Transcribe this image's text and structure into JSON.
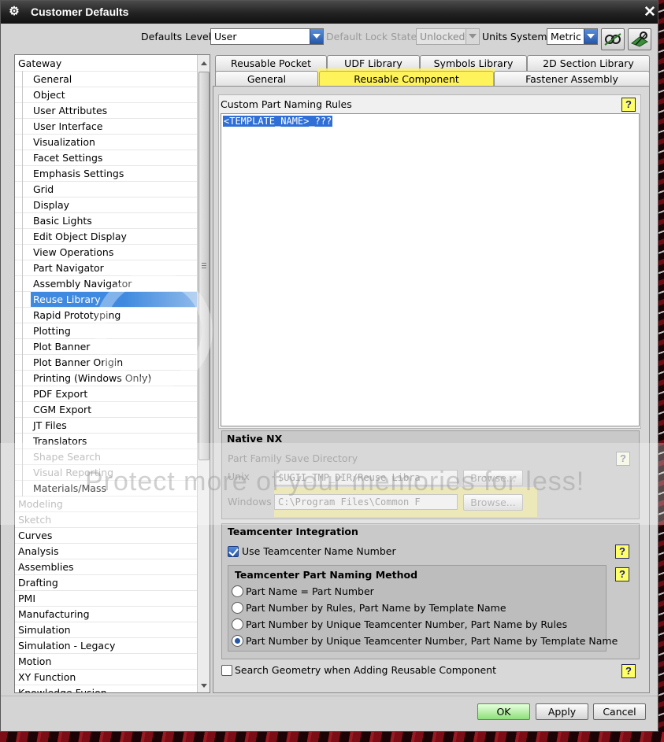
{
  "window": {
    "title": "Customer Defaults",
    "close_glyph": "✕",
    "app_icon": "gear-icon"
  },
  "toolbar": {
    "defaults_level_label": "Defaults Level",
    "defaults_level_value": "User",
    "lock_state_label": "Default Lock State",
    "lock_state_value": "Unlocked",
    "units_label": "Units System",
    "units_value": "Metric",
    "icons": [
      "find-default-icon",
      "manage-defaults-icon"
    ]
  },
  "nav": {
    "items": [
      {
        "label": "Gateway",
        "level": 1
      },
      {
        "label": "General",
        "level": 2
      },
      {
        "label": "Object",
        "level": 2
      },
      {
        "label": "User Attributes",
        "level": 2
      },
      {
        "label": "User Interface",
        "level": 2
      },
      {
        "label": "Visualization",
        "level": 2
      },
      {
        "label": "Facet Settings",
        "level": 2
      },
      {
        "label": "Emphasis Settings",
        "level": 2
      },
      {
        "label": "Grid",
        "level": 2
      },
      {
        "label": "Display",
        "level": 2
      },
      {
        "label": "Basic Lights",
        "level": 2
      },
      {
        "label": "Edit Object Display",
        "level": 2
      },
      {
        "label": "View Operations",
        "level": 2
      },
      {
        "label": "Part Navigator",
        "level": 2
      },
      {
        "label": "Assembly Navigator",
        "level": 2
      },
      {
        "label": "Reuse Library",
        "level": 2,
        "selected": true
      },
      {
        "label": "Rapid Prototyping",
        "level": 2
      },
      {
        "label": "Plotting",
        "level": 2
      },
      {
        "label": "Plot Banner",
        "level": 2
      },
      {
        "label": "Plot Banner Origin",
        "level": 2
      },
      {
        "label": "Printing (Windows Only)",
        "level": 2
      },
      {
        "label": "PDF Export",
        "level": 2
      },
      {
        "label": "CGM Export",
        "level": 2
      },
      {
        "label": "JT Files",
        "level": 2
      },
      {
        "label": "Translators",
        "level": 2
      },
      {
        "label": "Shape Search",
        "level": 2,
        "grey": true
      },
      {
        "label": "Visual Reporting",
        "level": 2,
        "grey": true
      },
      {
        "label": "Materials/Mass",
        "level": 2
      },
      {
        "label": "Modeling",
        "level": 1,
        "grey": true
      },
      {
        "label": "Sketch",
        "level": 1,
        "grey": true
      },
      {
        "label": "Curves",
        "level": 1
      },
      {
        "label": "Analysis",
        "level": 1
      },
      {
        "label": "Assemblies",
        "level": 1
      },
      {
        "label": "Drafting",
        "level": 1
      },
      {
        "label": "PMI",
        "level": 1
      },
      {
        "label": "Manufacturing",
        "level": 1
      },
      {
        "label": "Simulation",
        "level": 1
      },
      {
        "label": "Simulation - Legacy",
        "level": 1
      },
      {
        "label": "Motion",
        "level": 1
      },
      {
        "label": "XY Function",
        "level": 1
      },
      {
        "label": "Knowledge Fusion",
        "level": 1
      }
    ]
  },
  "tabs": {
    "row1": [
      "Reusable Pocket",
      "UDF Library",
      "Symbols Library",
      "2D Section Library"
    ],
    "row2": [
      "General",
      "Reusable Component",
      "Fastener Assembly"
    ],
    "active": "Reusable Component"
  },
  "naming": {
    "title": "Custom Part Naming Rules",
    "value": "<TEMPLATE_NAME>_???"
  },
  "native_nx": {
    "title": "Native NX",
    "save_dir_label": "Part Family Save Directory",
    "unix_label": "Unix",
    "unix_value": "$UGII_TMP_DIR/Reuse Libra",
    "windows_label": "Windows",
    "windows_value": "C:\\Program Files\\Common F",
    "browse_label": "Browse..."
  },
  "teamcenter": {
    "title": "Teamcenter Integration",
    "use_name_number_label": "Use Teamcenter Name Number",
    "use_name_number_checked": true,
    "method_title": "Teamcenter Part Naming Method",
    "methods": [
      {
        "label": "Part Name = Part Number",
        "checked": false
      },
      {
        "label": "Part Number by Rules, Part Name by Template Name",
        "checked": false
      },
      {
        "label": "Part Number by Unique Teamcenter Number, Part Name by Rules",
        "checked": false
      },
      {
        "label": "Part Number by Unique Teamcenter Number, Part Name by Template Name",
        "checked": true
      }
    ]
  },
  "search_geometry": {
    "label": "Search Geometry when Adding Reusable Component",
    "checked": false
  },
  "help_glyph": "?",
  "watermark": {
    "text": "Protect more of your memories for less!"
  },
  "buttons": {
    "ok": "OK",
    "apply": "Apply",
    "cancel": "Cancel"
  },
  "colors": {
    "highlight": "#fff35c",
    "selection": "#3f8ae0",
    "ok_button": "#8ee07a"
  }
}
